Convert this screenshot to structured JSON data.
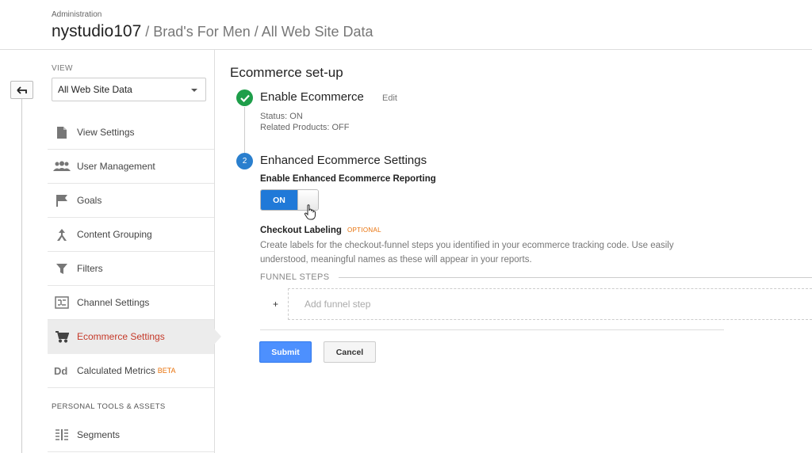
{
  "header": {
    "admin_label": "Administration",
    "account_name": "nystudio107",
    "breadcrumb": " / Brad's For Men / All Web Site Data"
  },
  "sidebar": {
    "view_label": "VIEW",
    "view_selected": "All Web Site Data",
    "items": [
      {
        "label": "View Settings",
        "icon": "document-icon"
      },
      {
        "label": "User Management",
        "icon": "users-icon"
      },
      {
        "label": "Goals",
        "icon": "flag-icon"
      },
      {
        "label": "Content Grouping",
        "icon": "content-grouping-icon"
      },
      {
        "label": "Filters",
        "icon": "filter-icon"
      },
      {
        "label": "Channel Settings",
        "icon": "channel-icon"
      },
      {
        "label": "Ecommerce Settings",
        "icon": "cart-icon",
        "active": true
      },
      {
        "label": "Calculated Metrics",
        "icon": "dd-icon",
        "badge": "BETA"
      }
    ],
    "section_title": "PERSONAL TOOLS & ASSETS",
    "tools": [
      {
        "label": "Segments",
        "icon": "segments-icon"
      }
    ]
  },
  "main": {
    "title": "Ecommerce set-up",
    "step1": {
      "title": "Enable Ecommerce",
      "edit": "Edit",
      "status": "Status: ON",
      "related": "Related Products: OFF"
    },
    "step2": {
      "number": "2",
      "title": "Enhanced Ecommerce Settings",
      "enable_label": "Enable Enhanced Ecommerce Reporting",
      "toggle_label": "ON",
      "toggle_state": "on",
      "checkout_label": "Checkout Labeling",
      "optional": "OPTIONAL",
      "description": "Create labels for the checkout-funnel steps you identified in your ecommerce tracking code. Use easily understood, meaningful names as these will appear in your reports.",
      "funnel_label": "FUNNEL STEPS",
      "plus": "+",
      "add_step": "Add funnel step"
    },
    "submit": "Submit",
    "cancel": "Cancel"
  },
  "colors": {
    "active_text": "#c53929",
    "accent_blue": "#4d90fe",
    "toggle_blue": "#2079d8",
    "check_green": "#1e9e4a",
    "step_blue": "#2a7fce",
    "optional_orange": "#e8710a"
  }
}
